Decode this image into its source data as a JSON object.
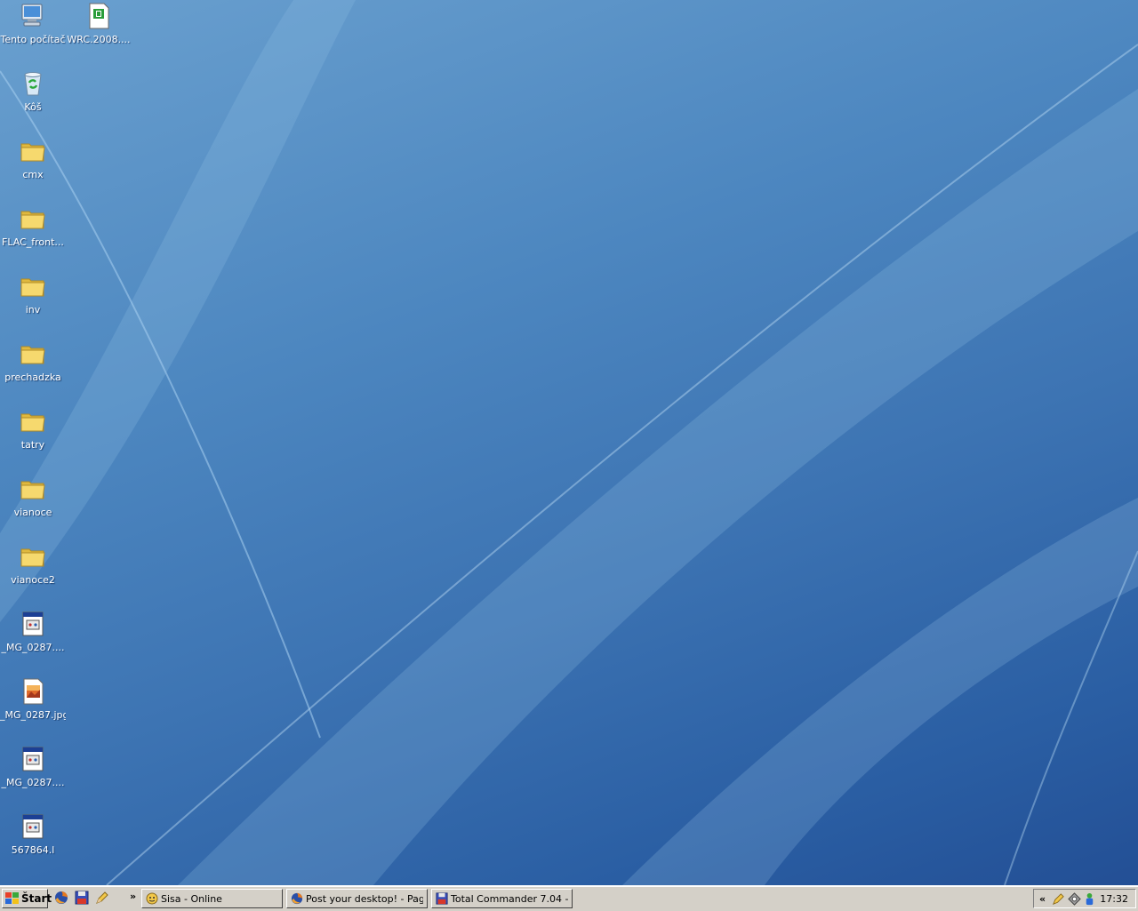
{
  "desktop": {
    "icons": [
      {
        "label": "Tento počítač",
        "type": "computer-icon"
      },
      {
        "label": "WRC.2008....",
        "type": "document-icon"
      },
      {
        "label": "Kôš",
        "type": "recycle-bin-icon"
      },
      {
        "label": "cmx",
        "type": "folder-icon"
      },
      {
        "label": "FLAC_front...",
        "type": "folder-icon"
      },
      {
        "label": "inv",
        "type": "folder-icon"
      },
      {
        "label": "prechadzka",
        "type": "folder-icon"
      },
      {
        "label": "tatry",
        "type": "folder-icon"
      },
      {
        "label": "vianoce",
        "type": "folder-icon"
      },
      {
        "label": "vianoce2",
        "type": "folder-icon"
      },
      {
        "label": "_MG_0287....",
        "type": "app-file-icon"
      },
      {
        "label": "_MG_0287.jpg",
        "type": "image-file-icon"
      },
      {
        "label": "_MG_0287....",
        "type": "app-file-icon"
      },
      {
        "label": "567864.l",
        "type": "app-file-icon"
      }
    ]
  },
  "taskbar": {
    "start_label": "Štart",
    "quicklaunch_overflow": "»",
    "tasks": [
      {
        "label": "Sisa - Online",
        "icon": "messenger-icon"
      },
      {
        "label": "Post your desktop! - Pag...",
        "icon": "firefox-icon"
      },
      {
        "label": "Total Commander 7.04 - ...",
        "icon": "floppy-icon"
      }
    ],
    "tray": {
      "expand": "«",
      "time": "17:32"
    }
  },
  "colors": {
    "taskbar": "#d4d0c8",
    "desktop": "#3d74b3",
    "folder": "#f3d466"
  }
}
